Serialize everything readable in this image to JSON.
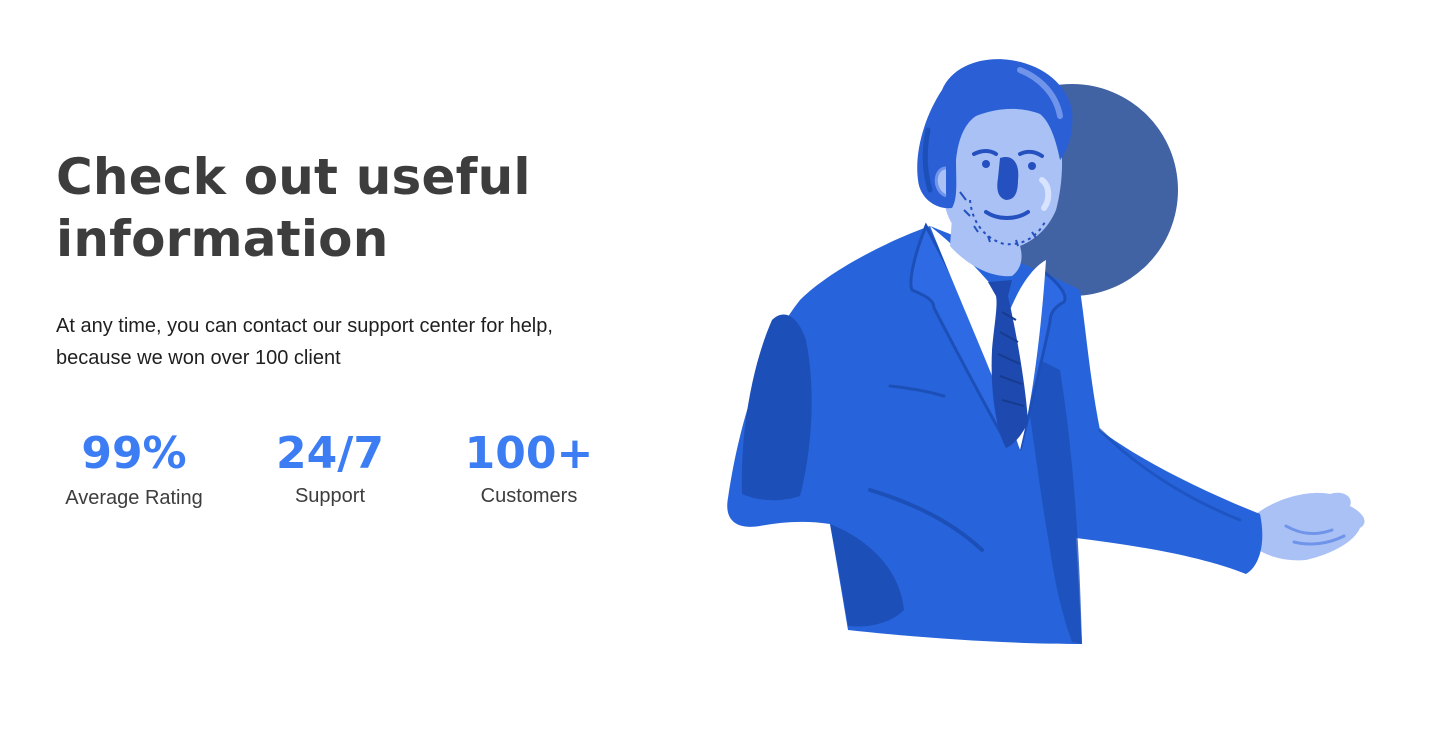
{
  "hero": {
    "title": "Check out useful information",
    "description": "At any time, you can contact our support center for help, because we won over 100 client"
  },
  "stats": [
    {
      "value": "99%",
      "label": "Average Rating"
    },
    {
      "value": "24/7",
      "label": "Support"
    },
    {
      "value": "100+",
      "label": "Customers"
    }
  ],
  "illustration": {
    "icon": "businessman-illustration",
    "colors": {
      "suit": "#2764db",
      "suit_shadow": "#1d4fb8",
      "circle": "#4263a3",
      "skin": "#a9c1f5",
      "hair": "#2a5fd6",
      "shirt": "#ffffff",
      "tie": "#1e4ab0"
    }
  },
  "accent_color": "#3d7df4",
  "text_color": "#3d3d3d"
}
